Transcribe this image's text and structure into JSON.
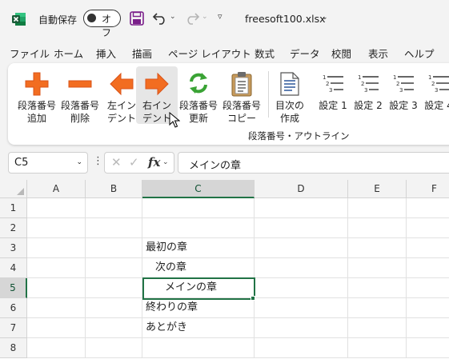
{
  "app": {
    "autosave_label": "自動保存",
    "autosave_state": "オフ",
    "filename": "freesoft100.xlsx",
    "accent": "#217346"
  },
  "menu": [
    "ファイル",
    "ホーム",
    "挿入",
    "描画",
    "ページ レイアウト",
    "数式",
    "データ",
    "校閲",
    "表示",
    "ヘルプ"
  ],
  "ribbon": {
    "buttons": [
      {
        "l1": "段落番号",
        "l2": "追加",
        "icon": "plus-icon"
      },
      {
        "l1": "段落番号",
        "l2": "削除",
        "icon": "minus-icon"
      },
      {
        "l1": "左イン",
        "l2": "デント",
        "icon": "arrow-left-icon"
      },
      {
        "l1": "右イン",
        "l2": "デント",
        "icon": "arrow-right-icon"
      },
      {
        "l1": "段落番号",
        "l2": "更新",
        "icon": "refresh-icon"
      },
      {
        "l1": "段落番号",
        "l2": "コピー",
        "icon": "clipboard-icon"
      },
      {
        "l1": "目次の",
        "l2": "作成",
        "icon": "document-icon"
      }
    ],
    "settings": [
      "設定 1",
      "設定 2",
      "設定 3",
      "設定 4"
    ],
    "group_label": "段落番号・アウトライン"
  },
  "formula": {
    "name_box": "C5",
    "fx": "fx",
    "content": "メインの章"
  },
  "grid": {
    "columns": [
      "A",
      "B",
      "C",
      "D",
      "E",
      "F"
    ],
    "rows": [
      "1",
      "2",
      "3",
      "4",
      "5",
      "6",
      "7",
      "8"
    ],
    "active_cell": "C5",
    "cells": {
      "c3": "最初の章",
      "c4": "次の章",
      "c5": "メインの章",
      "c6": "終わりの章",
      "c7": "あとがき"
    }
  }
}
